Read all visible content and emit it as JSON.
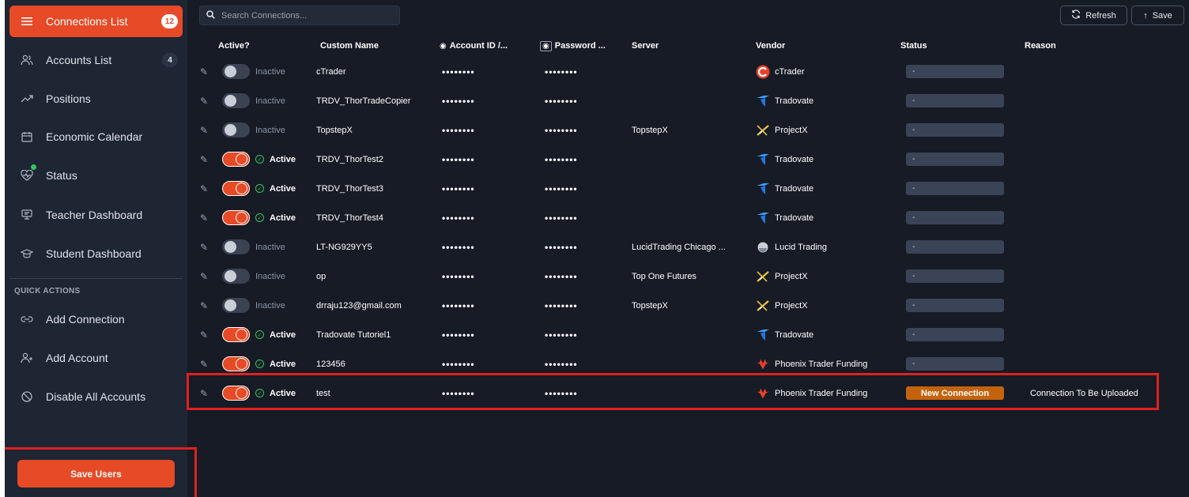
{
  "sidebar": {
    "items": [
      {
        "label": "Connections List",
        "badge": "12",
        "icon": "list-icon",
        "active": true
      },
      {
        "label": "Accounts List",
        "badge": "4",
        "icon": "users-icon"
      },
      {
        "label": "Positions",
        "icon": "trend-icon"
      },
      {
        "label": "Economic Calendar",
        "icon": "calendar-icon"
      },
      {
        "label": "Status",
        "icon": "heartbeat-icon"
      },
      {
        "label": "Teacher Dashboard",
        "icon": "teacher-icon"
      },
      {
        "label": "Student Dashboard",
        "icon": "graduation-cap-icon"
      }
    ],
    "quick_actions_title": "QUICK ACTIONS",
    "quick_actions": [
      {
        "label": "Add Connection",
        "icon": "link-icon"
      },
      {
        "label": "Add Account",
        "icon": "user-plus-icon"
      },
      {
        "label": "Disable All Accounts",
        "icon": "ban-icon"
      }
    ],
    "save_users": "Save Users"
  },
  "toolbar": {
    "search_placeholder": "Search Connections...",
    "refresh_label": "Refresh",
    "save_label": "Save"
  },
  "table": {
    "headers": {
      "active": "Active?",
      "custom_name": "Custom Name",
      "account_id": "Account ID /...",
      "password": "Password ...",
      "server": "Server",
      "vendor": "Vendor",
      "status": "Status",
      "reason": "Reason"
    },
    "rows": [
      {
        "active": false,
        "state": "Inactive",
        "name": "cTrader",
        "account_id": "••••••••",
        "password": "••••••••",
        "server": "",
        "vendor": "cTrader",
        "vendor_icon": "ctrader-logo-icon",
        "status": "-",
        "reason": ""
      },
      {
        "active": false,
        "state": "Inactive",
        "name": "TRDV_ThorTradeCopier",
        "account_id": "••••••••",
        "password": "••••••••",
        "server": "",
        "vendor": "Tradovate",
        "vendor_icon": "tradovate-logo-icon",
        "status": "-",
        "reason": ""
      },
      {
        "active": false,
        "state": "Inactive",
        "name": "TopstepX",
        "account_id": "••••••••",
        "password": "••••••••",
        "server": "TopstepX",
        "vendor": "ProjectX",
        "vendor_icon": "projectx-logo-icon",
        "status": "-",
        "reason": ""
      },
      {
        "active": true,
        "state": "Active",
        "name": "TRDV_ThorTest2",
        "account_id": "••••••••",
        "password": "••••••••",
        "server": "",
        "vendor": "Tradovate",
        "vendor_icon": "tradovate-logo-icon",
        "status": "-",
        "reason": ""
      },
      {
        "active": true,
        "state": "Active",
        "name": "TRDV_ThorTest3",
        "account_id": "••••••••",
        "password": "••••••••",
        "server": "",
        "vendor": "Tradovate",
        "vendor_icon": "tradovate-logo-icon",
        "status": "-",
        "reason": ""
      },
      {
        "active": true,
        "state": "Active",
        "name": "TRDV_ThorTest4",
        "account_id": "••••••••",
        "password": "••••••••",
        "server": "",
        "vendor": "Tradovate",
        "vendor_icon": "tradovate-logo-icon",
        "status": "-",
        "reason": ""
      },
      {
        "active": false,
        "state": "Inactive",
        "name": "LT-NG929YY5",
        "account_id": "••••••••",
        "password": "••••••••",
        "server": "LucidTrading Chicago ...",
        "vendor": "Lucid Trading",
        "vendor_icon": "lucid-logo-icon",
        "status": "-",
        "reason": ""
      },
      {
        "active": false,
        "state": "Inactive",
        "name": "op",
        "account_id": "••••••••",
        "password": "••••••••",
        "server": "Top One Futures",
        "vendor": "ProjectX",
        "vendor_icon": "projectx-logo-icon",
        "status": "-",
        "reason": ""
      },
      {
        "active": false,
        "state": "Inactive",
        "name": "drraju123@gmail.com",
        "account_id": "••••••••",
        "password": "••••••••",
        "server": "TopstepX",
        "vendor": "ProjectX",
        "vendor_icon": "projectx-logo-icon",
        "status": "-",
        "reason": ""
      },
      {
        "active": true,
        "state": "Active",
        "name": "Tradovate Tutoriel1",
        "account_id": "••••••••",
        "password": "••••••••",
        "server": "",
        "vendor": "Tradovate",
        "vendor_icon": "tradovate-logo-icon",
        "status": "-",
        "reason": ""
      },
      {
        "active": true,
        "state": "Active",
        "name": "123456",
        "account_id": "••••••••",
        "password": "••••••••",
        "server": "",
        "vendor": "Phoenix Trader Funding",
        "vendor_icon": "phoenix-logo-icon",
        "status": "-",
        "reason": ""
      },
      {
        "active": true,
        "state": "Active",
        "name": "test",
        "account_id": "••••••••",
        "password": "••••••••",
        "server": "",
        "vendor": "Phoenix Trader Funding",
        "vendor_icon": "phoenix-logo-icon",
        "status": "New Connection",
        "status_new": true,
        "reason": "Connection To Be Uploaded"
      }
    ]
  },
  "colors": {
    "accent": "#e64a26",
    "background": "#161b25",
    "sidebar": "#1e2533",
    "status_new": "#c4620e",
    "highlight": "#e02020"
  }
}
